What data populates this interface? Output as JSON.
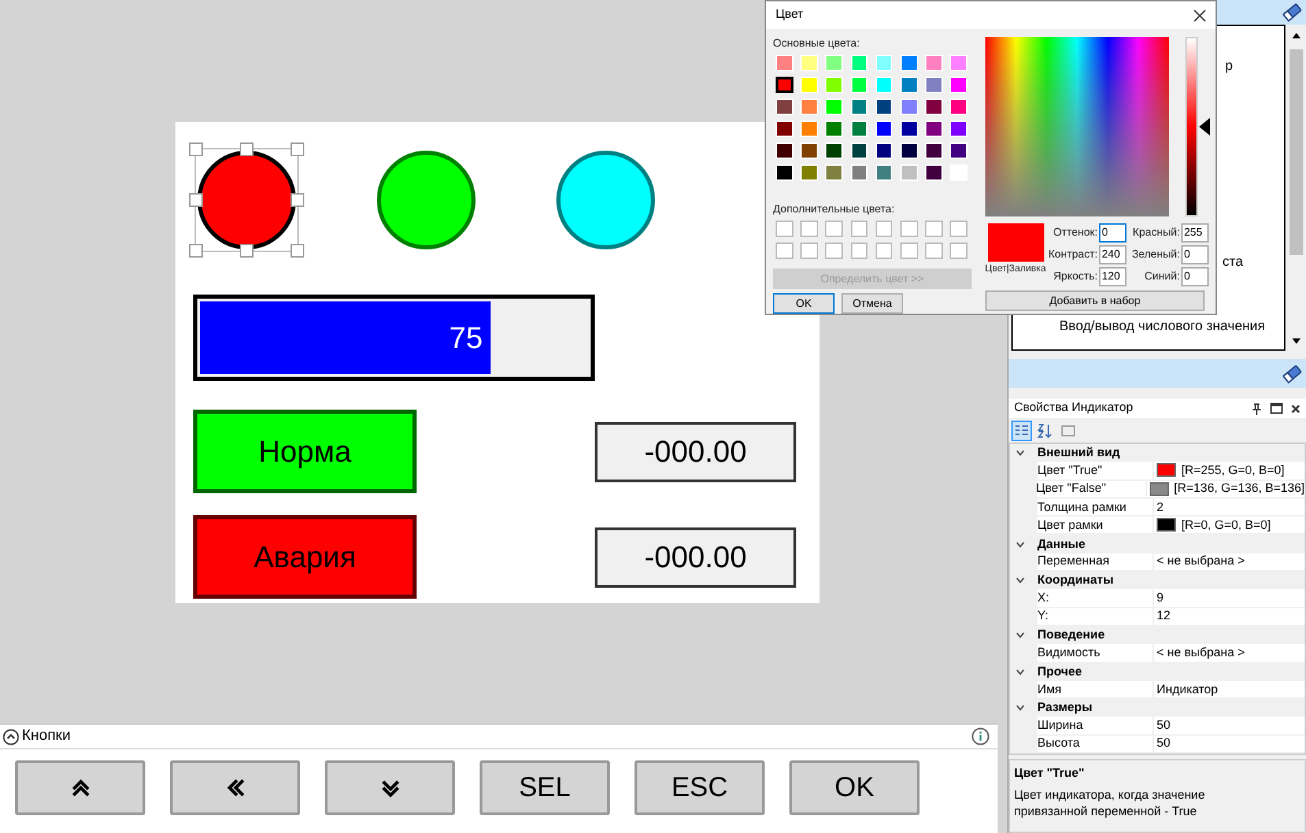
{
  "canvas": {
    "indicators": [
      {
        "color": "#ff0000",
        "selected": true
      },
      {
        "color": "#00ff00",
        "selected": false
      },
      {
        "color": "#00ffff",
        "selected": false
      }
    ],
    "bar": {
      "level": 0.75,
      "reading": "75"
    },
    "labels": [
      {
        "text": "Норма",
        "color": "#00ff00"
      },
      {
        "text": "Авария",
        "color": "#ff0000"
      }
    ],
    "values": [
      "-000.00",
      "-000.00"
    ]
  },
  "buttons_panel": {
    "title": "Кнопки",
    "expanded": true,
    "buttons": [
      {
        "kind": "up"
      },
      {
        "kind": "left"
      },
      {
        "kind": "down"
      },
      {
        "kind": "text",
        "label": "SEL"
      },
      {
        "kind": "text",
        "label": "ESC"
      },
      {
        "kind": "text",
        "label": "OK"
      }
    ]
  },
  "toolbox": {
    "items": [
      "р",
      "ста",
      "Ввод/вывод числового значения"
    ]
  },
  "properties": {
    "title": "Свойства Индикатор",
    "sort_buttons": [
      {
        "kind": "categorized",
        "selected": true
      },
      {
        "kind": "alphabetical",
        "selected": false
      },
      {
        "kind": "pages",
        "selected": false
      }
    ],
    "categories": [
      {
        "name": "Внешний вид",
        "expanded": true,
        "rows": [
          {
            "label": "Цвет \"True\"",
            "value": "[R=255, G=0, B=0]",
            "color": "#ff0000"
          },
          {
            "label": "Цвет \"False\"",
            "value": "[R=136, G=136, B=136]",
            "color": "#888888"
          },
          {
            "label": "Толщина рамки",
            "value": "2"
          },
          {
            "label": "Цвет рамки",
            "value": "[R=0, G=0, B=0]",
            "color": "#000000"
          }
        ]
      },
      {
        "name": "Данные",
        "expanded": true,
        "rows": [
          {
            "label": "Переменная",
            "value": "< не выбрана >"
          }
        ]
      },
      {
        "name": "Координаты",
        "expanded": true,
        "rows": [
          {
            "label": "X:",
            "value": "9"
          },
          {
            "label": "Y:",
            "value": "12"
          }
        ]
      },
      {
        "name": "Поведение",
        "expanded": true,
        "rows": [
          {
            "label": "Видимость",
            "value": "< не выбрана >"
          }
        ]
      },
      {
        "name": "Прочее",
        "expanded": true,
        "rows": [
          {
            "label": "Имя",
            "value": "Индикатор"
          }
        ]
      },
      {
        "name": "Размеры",
        "expanded": true,
        "rows": [
          {
            "label": "Ширина",
            "value": "50"
          },
          {
            "label": "Высота",
            "value": "50"
          }
        ]
      }
    ],
    "help_title": "Цвет \"True\"",
    "help_text": "Цвет индикатора, когда значение привязанной переменной - True"
  },
  "color_dialog": {
    "title": "Цвет",
    "basic_label": "Основные цвета:",
    "basic_colors": [
      {
        "color": "#ff8080",
        "selected": false
      },
      {
        "color": "#ffff80",
        "selected": false
      },
      {
        "color": "#80ff80",
        "selected": false
      },
      {
        "color": "#00ff80",
        "selected": false
      },
      {
        "color": "#80ffff",
        "selected": false
      },
      {
        "color": "#0080ff",
        "selected": false
      },
      {
        "color": "#ff80c0",
        "selected": false
      },
      {
        "color": "#ff80ff",
        "selected": false
      },
      {
        "color": "#ff0000",
        "selected": true
      },
      {
        "color": "#ffff00",
        "selected": false
      },
      {
        "color": "#80ff00",
        "selected": false
      },
      {
        "color": "#00ff40",
        "selected": false
      },
      {
        "color": "#00ffff",
        "selected": false
      },
      {
        "color": "#0080c0",
        "selected": false
      },
      {
        "color": "#8080c0",
        "selected": false
      },
      {
        "color": "#ff00ff",
        "selected": false
      },
      {
        "color": "#804040",
        "selected": false
      },
      {
        "color": "#ff8040",
        "selected": false
      },
      {
        "color": "#00ff00",
        "selected": false
      },
      {
        "color": "#008080",
        "selected": false
      },
      {
        "color": "#004080",
        "selected": false
      },
      {
        "color": "#8080ff",
        "selected": false
      },
      {
        "color": "#800040",
        "selected": false
      },
      {
        "color": "#ff0080",
        "selected": false
      },
      {
        "color": "#800000",
        "selected": false
      },
      {
        "color": "#ff8000",
        "selected": false
      },
      {
        "color": "#008000",
        "selected": false
      },
      {
        "color": "#008040",
        "selected": false
      },
      {
        "color": "#0000ff",
        "selected": false
      },
      {
        "color": "#0000a0",
        "selected": false
      },
      {
        "color": "#800080",
        "selected": false
      },
      {
        "color": "#8000ff",
        "selected": false
      },
      {
        "color": "#400000",
        "selected": false
      },
      {
        "color": "#804000",
        "selected": false
      },
      {
        "color": "#004000",
        "selected": false
      },
      {
        "color": "#004040",
        "selected": false
      },
      {
        "color": "#000080",
        "selected": false
      },
      {
        "color": "#000040",
        "selected": false
      },
      {
        "color": "#400040",
        "selected": false
      },
      {
        "color": "#400080",
        "selected": false
      },
      {
        "color": "#000000",
        "selected": false
      },
      {
        "color": "#808000",
        "selected": false
      },
      {
        "color": "#808040",
        "selected": false
      },
      {
        "color": "#808080",
        "selected": false
      },
      {
        "color": "#408080",
        "selected": false
      },
      {
        "color": "#c0c0c0",
        "selected": false
      },
      {
        "color": "#400040",
        "selected": false
      },
      {
        "color": "#ffffff",
        "selected": false
      }
    ],
    "custom_label": "Дополнительные цвета:",
    "define_button": {
      "label": "Определить цвет >>",
      "disabled": true
    },
    "ok": "OK",
    "cancel": "Отмена",
    "preview": {
      "color": "#ff0000",
      "label": "Цвет|Заливка"
    },
    "fields": [
      {
        "label": "Оттенок:",
        "value": "0"
      },
      {
        "label": "Красный:",
        "value": "255"
      },
      {
        "label": "Контраст:",
        "value": "240"
      },
      {
        "label": "Зеленый:",
        "value": "0"
      },
      {
        "label": "Яркость:",
        "value": "120"
      },
      {
        "label": "Синий:",
        "value": "0"
      }
    ],
    "add_button": "Добавить в набор"
  }
}
